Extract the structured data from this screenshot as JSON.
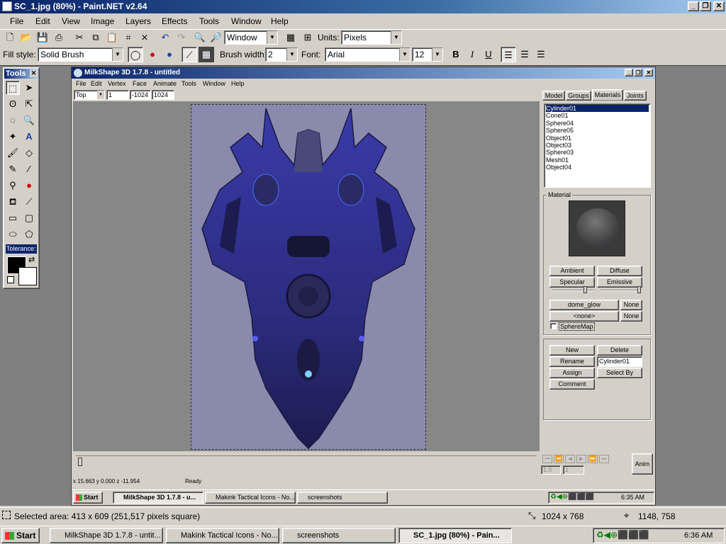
{
  "window": {
    "title": "SC_1.jpg (80%) - Paint.NET v2.64"
  },
  "menu": [
    "File",
    "Edit",
    "View",
    "Image",
    "Layers",
    "Effects",
    "Tools",
    "Window",
    "Help"
  ],
  "toolbar": {
    "window_combo": "Window",
    "units_label": "Units:",
    "units_value": "Pixels"
  },
  "options": {
    "fill_label": "Fill style:",
    "fill_value": "Solid Brush",
    "brush_label": "Brush width:",
    "brush_value": "2",
    "font_label": "Font:",
    "font_value": "Arial",
    "font_size": "12",
    "bold": "B",
    "italic": "I",
    "underline": "U"
  },
  "tools_panel": {
    "title": "Tools",
    "tolerance": "Tolerance:"
  },
  "milkshape": {
    "title": "MilkShape 3D 1.7.8 - untitled",
    "menu": [
      "File",
      "Edit",
      "Vertex",
      "Face",
      "Animate",
      "Tools",
      "Window",
      "Help"
    ],
    "view_value": "Top",
    "field1": "1",
    "field2": "-1024",
    "field3": "1024",
    "tabs": [
      "Model",
      "Groups",
      "Materials",
      "Joints"
    ],
    "materials_list": [
      "Cylinder01",
      "Cone01",
      "Sphere04",
      "Sphere05",
      "Object01",
      "Object03",
      "Sphere03",
      "Mesh01",
      "Object04"
    ],
    "material_group": "Material",
    "btn_ambient": "Ambient",
    "btn_diffuse": "Diffuse",
    "btn_specular": "Specular",
    "btn_emissive": "Emissive",
    "texture1": "dome_glow",
    "none1": "None",
    "texture2": "<none>",
    "none2": "None",
    "spheremap": "SphereMap",
    "btn_new": "New",
    "btn_delete": "Delete",
    "btn_rename": "Rename",
    "rename_value": "Cylinder01",
    "btn_assign": "Assign",
    "btn_selectby": "Select By",
    "btn_comment": "Comment",
    "anim_field1": "1.0",
    "anim_field2": "1",
    "btn_anim": "Anim",
    "status_coords": "x 15.663 y 0.000 z -11.954",
    "status_ready": "Ready",
    "task_start": "Start",
    "tasks": [
      "MilkShape 3D 1.7.8 - u...",
      "Makink Tactical Icons - No...",
      "screenshots"
    ],
    "clock": "6:35 AM"
  },
  "statusbar": {
    "selection": "Selected area: 413 x 609 (251,517 pixels square)",
    "size": "1024 x 768",
    "cursor": "1148, 758"
  },
  "taskbar": {
    "start": "Start",
    "tasks": [
      "MilkShape 3D 1.7.8 - untit...",
      "Makink Tactical Icons - No...",
      "screenshots",
      "SC_1.jpg (80%) - Pain..."
    ],
    "clock": "6:36 AM"
  }
}
